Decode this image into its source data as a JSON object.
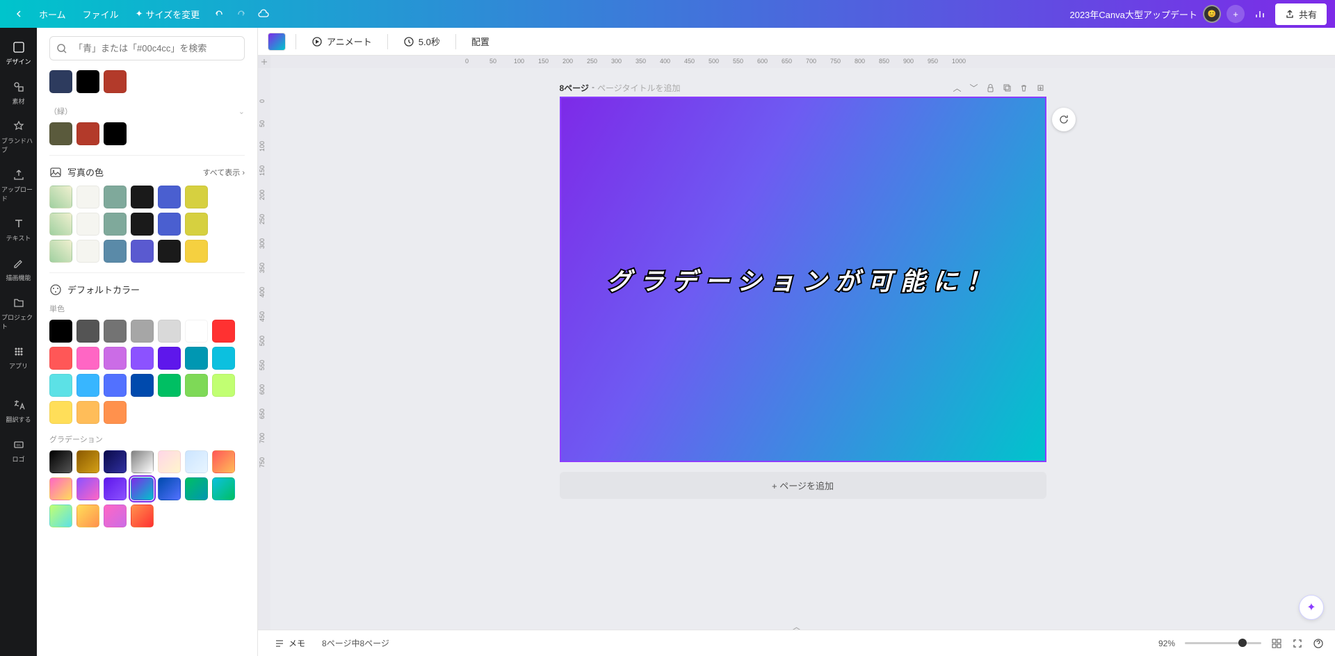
{
  "header": {
    "home": "ホーム",
    "file": "ファイル",
    "resize": "サイズを変更",
    "project_title": "2023年Canva大型アップデート",
    "share": "共有"
  },
  "nav": [
    {
      "label": "デザイン",
      "icon": "design"
    },
    {
      "label": "素材",
      "icon": "elements"
    },
    {
      "label": "ブランドハブ",
      "icon": "brandhub"
    },
    {
      "label": "アップロード",
      "icon": "upload"
    },
    {
      "label": "テキスト",
      "icon": "text"
    },
    {
      "label": "描画機能",
      "icon": "draw"
    },
    {
      "label": "プロジェクト",
      "icon": "projects"
    },
    {
      "label": "アプリ",
      "icon": "apps"
    },
    {
      "label": "翻訳する",
      "icon": "translate"
    },
    {
      "label": "ロゴ",
      "icon": "logo"
    }
  ],
  "search": {
    "placeholder": "「青」または「#00c4cc」を検索"
  },
  "sections": {
    "recent_colors": [
      "#2d3b5e",
      "#000000",
      "#b33a2a"
    ],
    "green_label": "（緑）",
    "green_colors": [
      "#5a5a3c",
      "#b33a2a",
      "#000000"
    ],
    "photo_colors_title": "写真の色",
    "show_all": "すべて表示",
    "photo_rows": [
      [
        "#f5f5f0",
        "#7fa99b",
        "#1a1a1a",
        "#4a5fd0",
        "#d6d040"
      ],
      [
        "#f5f5f0",
        "#7fa99b",
        "#1a1a1a",
        "#4a5fd0",
        "#d6d040"
      ],
      [
        "#f5f5f0",
        "#5a8aa8",
        "#5a5ad0",
        "#1a1a1a",
        "#f5d040"
      ]
    ],
    "default_title": "デフォルトカラー",
    "solid_label": "単色",
    "solid_colors": [
      "#000000",
      "#545454",
      "#737373",
      "#a6a6a6",
      "#d9d9d9",
      "#ffffff",
      "#ff3131",
      "#ff5757",
      "#ff66c4",
      "#cb6ce6",
      "#8c52ff",
      "#5e17eb",
      "#0097b2",
      "#0cc0df",
      "#5ce1e6",
      "#38b6ff",
      "#5271ff",
      "#004aad",
      "#00bf63",
      "#7ed957",
      "#c1ff72",
      "#ffde59",
      "#ffbd59",
      "#ff914d"
    ],
    "gradient_label": "グラデーション",
    "gradients": [
      "linear-gradient(135deg,#000000,#555555)",
      "linear-gradient(135deg,#8b5a00,#d4a017)",
      "linear-gradient(135deg,#0a0a4a,#3030a0)",
      "linear-gradient(135deg,#808080,#ffffff)",
      "linear-gradient(135deg,#ffd6e8,#fff5cc)",
      "linear-gradient(135deg,#cce5ff,#e8f5ff)",
      "linear-gradient(135deg,#ff5757,#ffbd59)",
      "linear-gradient(135deg,#ff66c4,#ffde59)",
      "linear-gradient(135deg,#8c52ff,#ff66c4)",
      "linear-gradient(135deg,#5e17eb,#8c52ff)",
      "linear-gradient(135deg,#7d2ae8,#00c4cc)",
      "linear-gradient(135deg,#004aad,#5271ff)",
      "linear-gradient(135deg,#00bf63,#0097b2)",
      "linear-gradient(135deg,#0cc0df,#00bf63)",
      "linear-gradient(135deg,#c1ff72,#5ce1e6)",
      "linear-gradient(135deg,#ffde59,#ff914d)",
      "linear-gradient(135deg,#ff66c4,#cb6ce6)",
      "linear-gradient(135deg,#ff914d,#ff3131)"
    ],
    "selected_gradient_index": 10
  },
  "toolbar": {
    "animate": "アニメート",
    "duration": "5.0秒",
    "position": "配置"
  },
  "page": {
    "number": "8ページ",
    "sep": " - ",
    "title_hint": "ページタイトルを追加",
    "canvas_text": "グラデーションが可能に！",
    "add_page": "+ ページを追加"
  },
  "ruler": {
    "h_ticks": [
      "0",
      "50",
      "100",
      "150",
      "200",
      "250",
      "300",
      "350",
      "400",
      "450",
      "500",
      "550",
      "600",
      "650",
      "700",
      "750",
      "800",
      "850",
      "900",
      "950",
      "1000"
    ],
    "v_ticks": [
      "0",
      "50",
      "100",
      "150",
      "200",
      "250",
      "300",
      "350",
      "400",
      "450",
      "500",
      "550",
      "600",
      "650",
      "700",
      "750"
    ]
  },
  "bottom": {
    "notes": "メモ",
    "page_count": "8ページ中8ページ",
    "zoom": "92%"
  }
}
